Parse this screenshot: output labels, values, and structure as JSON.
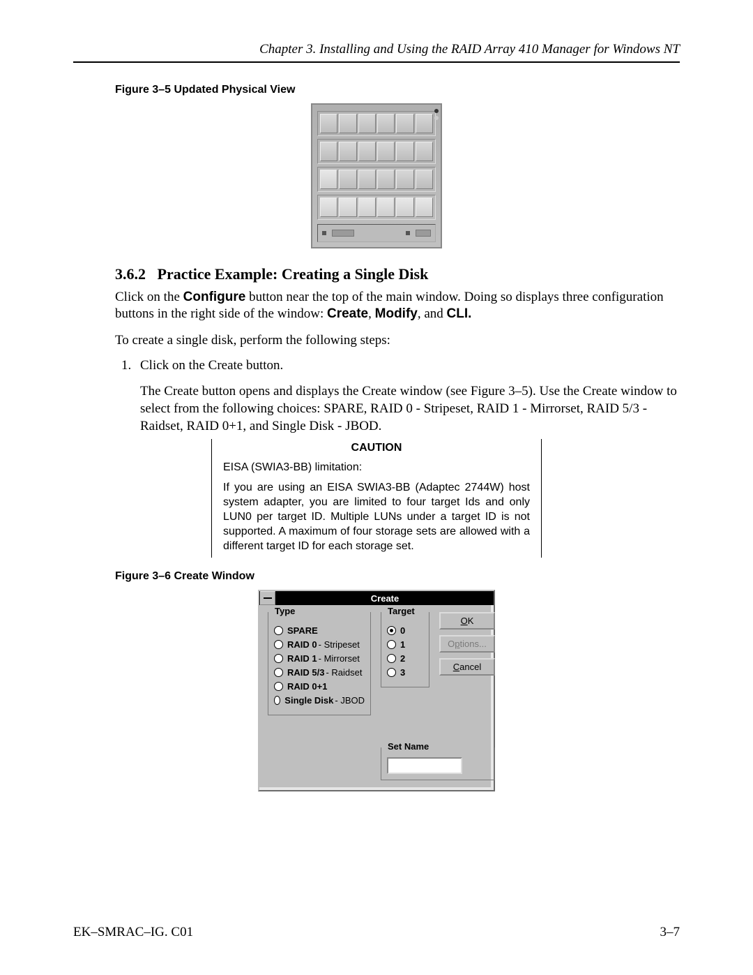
{
  "header": {
    "running_head": "Chapter 3.  Installing and Using the RAID Array 410 Manager for Windows NT"
  },
  "fig5": {
    "caption": "Figure 3–5  Updated Physical View"
  },
  "section": {
    "number": "3.6.2",
    "title": "Practice Example: Creating a Single Disk"
  },
  "para": {
    "p1a": "Click on the ",
    "p1b": "Configure",
    "p1c": " button near the top of the main window. Doing so displays three configuration buttons in the right side of the window: ",
    "p1d": "Create",
    "p1e": ", ",
    "p1f": "Modify",
    "p1g": ", and ",
    "p1h": "CLI.",
    "p2": "To create a single disk, perform the following steps:",
    "s1a": "Click on the ",
    "s1b": "Create",
    "s1c": " button.",
    "sub_a": "The ",
    "sub_b": "Create",
    "sub_c": " button opens and displays the ",
    "sub_d": "Create",
    "sub_e": " window (see Figure 3–5). Use the Create window to select from the following choices: ",
    "sub_f": "SPARE, RAID 0 - Stripeset",
    "sub_g": ", ",
    "sub_h": "RAID 1 - Mirrorset",
    "sub_i": ", ",
    "sub_j": "RAID 5/3 - Raidset",
    "sub_k": ", ",
    "sub_l": "RAID 0+1",
    "sub_m": ", and ",
    "sub_n": "Single Disk - JBOD."
  },
  "caution": {
    "title": "CAUTION",
    "line1": "EISA (SWIA3-BB) limitation:",
    "body": "If you are using an EISA SWIA3-BB (Adaptec 2744W) host system adapter, you are limited to four target Ids and only LUN0 per target ID. Multiple LUNs under a target ID is not supported. A maximum of four storage sets are allowed with a different target ID for each storage set."
  },
  "fig6": {
    "caption": "Figure 3–6  Create Window"
  },
  "create_win": {
    "title": "Create",
    "type_legend": "Type",
    "target_legend": "Target",
    "setname_legend": "Set Name",
    "types": [
      {
        "bold": "SPARE",
        "sub": ""
      },
      {
        "bold": "RAID 0",
        "sub": " - Stripeset"
      },
      {
        "bold": "RAID 1",
        "sub": " - Mirrorset"
      },
      {
        "bold": "RAID 5/3",
        "sub": " - Raidset"
      },
      {
        "bold": "RAID 0+1",
        "sub": ""
      },
      {
        "bold": "Single Disk",
        "sub": " - JBOD"
      }
    ],
    "targets": [
      "0",
      "1",
      "2",
      "3"
    ],
    "selected_target": "0",
    "buttons": {
      "ok": "OK",
      "options": "Options...",
      "cancel": "Cancel"
    }
  },
  "footer": {
    "left": "EK–SMRAC–IG. C01",
    "right": "3–7"
  }
}
